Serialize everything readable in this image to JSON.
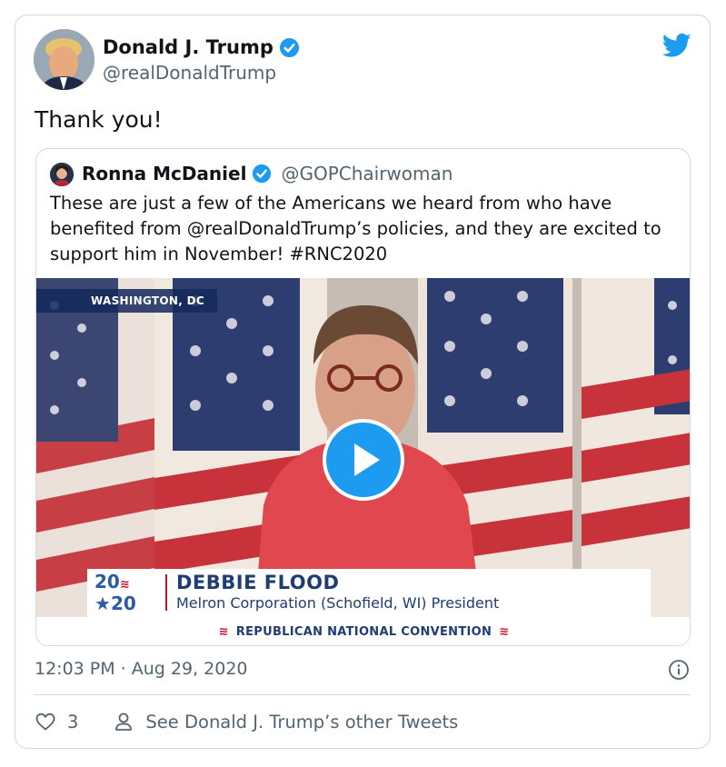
{
  "tweet": {
    "author_name": "Donald J. Trump",
    "author_handle": "@realDonaldTrump",
    "text": "Thank you!",
    "timestamp": "12:03 PM · Aug 29, 2020",
    "likes": "3",
    "see_other_tweets": "See Donald J. Trump’s other Tweets"
  },
  "quoted_tweet": {
    "author_name": "Ronna McDaniel",
    "author_handle": "@GOPChairwoman",
    "text": "These are just a few of the Americans we heard from who have benefited from @realDonaldTrump’s policies, and they are excited to support him in November! #RNC2020"
  },
  "video": {
    "location_tag": "WASHINGTON, DC",
    "logo_text_top": "20",
    "logo_text_bottom": "20",
    "speaker_name": "DEBBIE FLOOD",
    "speaker_title": "Melron Corporation (Schofield, WI) President",
    "footer_text": "REPUBLICAN NATIONAL CONVENTION"
  },
  "colors": {
    "twitter_blue": "#1d9bf0",
    "verified_blue": "#1d9bf0",
    "rnc_red": "#c8102e",
    "rnc_navy": "#1f3c74"
  },
  "icons": {
    "verified": "verified-badge-icon",
    "twitter": "twitter-bird-icon",
    "info": "info-icon",
    "like": "heart-icon",
    "profile": "person-icon",
    "play": "play-icon"
  }
}
